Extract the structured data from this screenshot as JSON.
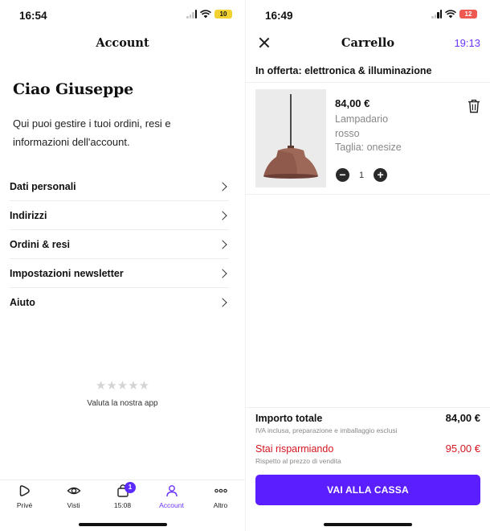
{
  "left": {
    "status": {
      "time": "16:54",
      "battery": "10"
    },
    "header": {
      "title": "Account"
    },
    "greeting": "Ciao Giuseppe",
    "intro": "Qui puoi gestire i tuoi ordini, resi e informazioni dell'account.",
    "menu": [
      {
        "label": "Dati personali"
      },
      {
        "label": "Indirizzi"
      },
      {
        "label": "Ordini & resi"
      },
      {
        "label": "Impostazioni newsletter"
      },
      {
        "label": "Aiuto"
      }
    ],
    "rating": {
      "stars": "★★★★★",
      "label": "Valuta la nostra app"
    },
    "tabbar": {
      "tabs": [
        {
          "label": "Privé",
          "icon": "prive-play-icon"
        },
        {
          "label": "Visti",
          "icon": "eye-icon"
        },
        {
          "label": "15:08",
          "icon": "bag-icon",
          "badge": "1"
        },
        {
          "label": "Account",
          "icon": "person-icon",
          "active": true
        },
        {
          "label": "Altro",
          "icon": "more-dots-icon"
        }
      ]
    }
  },
  "right": {
    "status": {
      "time": "16:49",
      "battery": "12"
    },
    "header": {
      "title": "Carrello",
      "timer": "19:13"
    },
    "section_title": "In offerta: elettronica & illuminazione",
    "product": {
      "price": "84,00 €",
      "name_line1": "Lampadario",
      "name_line2": "rosso",
      "size": "Taglia: onesize",
      "quantity": "1",
      "minus": "−",
      "plus": "+"
    },
    "summary": {
      "total_label": "Importo totale",
      "total_value": "84,00 €",
      "total_note": "IVA inclusa, preparazione e imballaggio esclusi",
      "saving_label": "Stai risparmiando",
      "saving_value": "95,00 €",
      "saving_note": "Rispetto al prezzo di vendita"
    },
    "checkout_label": "VAI ALLA CASSA"
  },
  "colors": {
    "accent": "#5b1fff",
    "accent_text": "#6a33ff",
    "saving_red": "#d5151f",
    "battery_low_left": "#f2d230",
    "battery_low_right": "#ee5a52"
  }
}
